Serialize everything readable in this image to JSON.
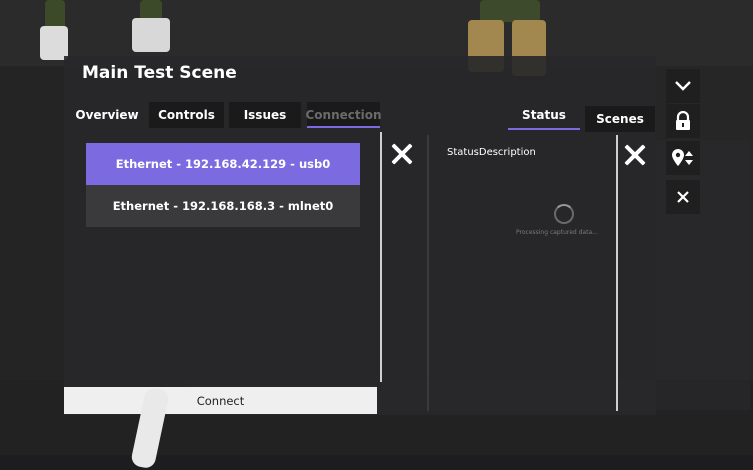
{
  "panel": {
    "title": "Main Test Scene"
  },
  "tabs": [
    {
      "label": "Overview"
    },
    {
      "label": "Controls"
    },
    {
      "label": "Issues"
    },
    {
      "label": "Connection"
    }
  ],
  "right_tabs": [
    {
      "label": "Status"
    },
    {
      "label": "Scenes"
    }
  ],
  "connections": [
    {
      "label": "Ethernet - 192.168.42.129 - usb0",
      "selected": true
    },
    {
      "label": "Ethernet - 192.168.168.3 - mlnet0",
      "selected": false
    }
  ],
  "status": {
    "description": "StatusDescription",
    "processing_text": "Processing captured data..."
  },
  "connect_button": {
    "label": "Connect"
  },
  "side_buttons": [
    {
      "icon": "chevron-down-icon"
    },
    {
      "icon": "lock-icon"
    },
    {
      "icon": "location-sort-icon"
    },
    {
      "icon": "close-icon"
    }
  ],
  "colors": {
    "accent": "#7c6be0",
    "panel": "#28282a"
  }
}
